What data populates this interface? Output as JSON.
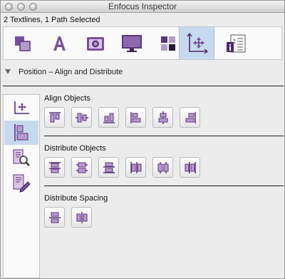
{
  "window": {
    "title": "Enfocus Inspector"
  },
  "selection_info": "2 Textlines, 1 Path Selected",
  "toolbar": {
    "tabs": [
      {
        "icon": "object-layers-icon"
      },
      {
        "icon": "text-icon"
      },
      {
        "icon": "image-camera-icon"
      },
      {
        "icon": "monitor-icon"
      },
      {
        "icon": "color-swatches-icon"
      },
      {
        "icon": "position-arrows-icon",
        "active": true
      },
      {
        "icon": "document-info-icon"
      }
    ]
  },
  "section": {
    "title": "Position – Align and Distribute"
  },
  "sidebar": {
    "items": [
      {
        "icon": "move-axes-icon"
      },
      {
        "icon": "align-panel-icon",
        "active": true
      },
      {
        "icon": "zoom-page-icon"
      },
      {
        "icon": "edit-page-icon"
      }
    ]
  },
  "groups": {
    "align": {
      "label": "Align Objects",
      "buttons": [
        "align-top-icon",
        "align-vertical-center-icon",
        "align-bottom-icon",
        "align-left-icon",
        "align-horizontal-center-icon",
        "align-right-icon"
      ]
    },
    "distribute": {
      "label": "Distribute Objects",
      "buttons": [
        "distribute-top-icon",
        "distribute-vertical-center-icon",
        "distribute-bottom-icon",
        "distribute-left-icon",
        "distribute-horizontal-center-icon",
        "distribute-right-icon"
      ]
    },
    "spacing": {
      "label": "Distribute Spacing",
      "buttons": [
        "distribute-vertical-spacing-icon",
        "distribute-horizontal-spacing-icon"
      ]
    }
  },
  "colors": {
    "accent": "#7a4f9e",
    "accent_light": "#b79acc",
    "selected": "#c6d9ee"
  }
}
